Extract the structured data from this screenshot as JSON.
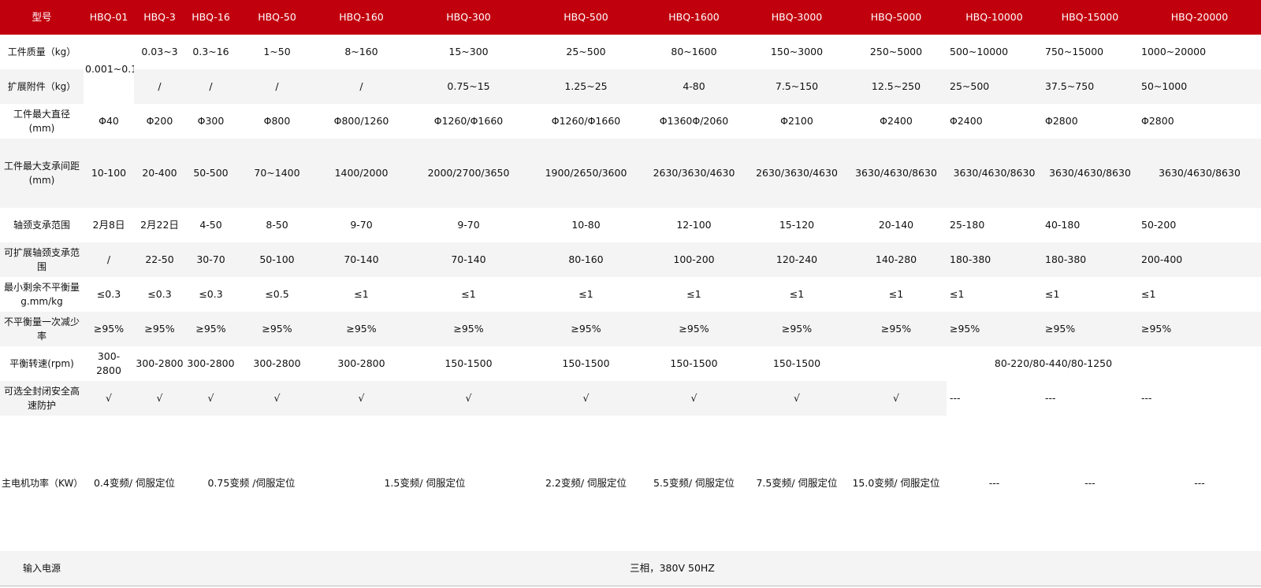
{
  "header": [
    "型号",
    "HBQ-01",
    "HBQ-3",
    "HBQ-16",
    "HBQ-50",
    "HBQ-160",
    "HBQ-300",
    "HBQ-500",
    "HBQ-1600",
    "HBQ-3000",
    "HBQ-5000",
    "HBQ-10000",
    "HBQ-15000",
    "HBQ-20000"
  ],
  "rows": {
    "mass": {
      "label": "工件质量（kg）",
      "hbq01": "0.001~0.1",
      "values": [
        "0.03~3",
        "0.3~16",
        "1~50",
        "8~160",
        "15~300",
        "25~500",
        "80~1600",
        "150~3000",
        "250~5000",
        "500~10000",
        "750~15000",
        "1000~20000"
      ]
    },
    "ext": {
      "label": "扩展附件（kg）",
      "values": [
        "/",
        "/",
        "/",
        "/",
        "0.75~15",
        "1.25~25",
        "4-80",
        "7.5~150",
        "12.5~250",
        "25~500",
        "37.5~750",
        "50~1000"
      ]
    },
    "diameter": {
      "label": "工件最大直径(mm)",
      "values": [
        "Φ40",
        "Φ200",
        "Φ300",
        "Φ800",
        "Φ800/1260",
        "Φ1260/Φ1660",
        "Φ1260/Φ1660",
        "Φ1360Φ/2060",
        "Φ2100",
        "Φ2400",
        "Φ2400",
        "Φ2800",
        "Φ2800"
      ]
    },
    "span": {
      "label": "工件最大支承间距(mm)",
      "values": [
        "10-100",
        "20-400",
        "50-500",
        "70~1400",
        "1400/2000",
        "2000/2700/3650",
        "1900/2650/3600",
        "2630/3630/4630",
        "2630/3630/4630",
        "3630/4630/8630",
        "3630/4630/8630",
        "3630/4630/8630",
        "3630/4630/8630"
      ]
    },
    "journal": {
      "label": "轴颈支承范围",
      "values": [
        "2月8日",
        "2月22日",
        "4-50",
        "8-50",
        "9-70",
        "9-70",
        "10-80",
        "12-100",
        "15-120",
        "20-140",
        "25-180",
        "40-180",
        "50-200"
      ]
    },
    "ext_journal": {
      "label": "可扩展轴颈支承范围",
      "values": [
        "/",
        "22-50",
        "30-70",
        "50-100",
        "70-140",
        "70-140",
        "80-160",
        "100-200",
        "120-240",
        "140-280",
        "180-380",
        "180-380",
        "200-400"
      ]
    },
    "min_unbalance": {
      "label": "最小剩余不平衡量g.mm/kg",
      "values": [
        "≤0.3",
        "≤0.3",
        "≤0.3",
        "≤0.5",
        "≤1",
        "≤1",
        "≤1",
        "≤1",
        "≤1",
        "≤1",
        "≤1",
        "≤1",
        "≤1"
      ]
    },
    "reduction": {
      "label": "不平衡量一次减少率",
      "values": [
        "≥95%",
        "≥95%",
        "≥95%",
        "≥95%",
        "≥95%",
        "≥95%",
        "≥95%",
        "≥95%",
        "≥95%",
        "≥95%",
        "≥95%",
        "≥95%",
        "≥95%"
      ]
    },
    "speed": {
      "label": "平衡转速(rpm)",
      "values": [
        "300-2800",
        "300-2800",
        "300-2800",
        "300-2800",
        "300-2800",
        "150-1500",
        "150-1500",
        "150-1500",
        "150-1500"
      ],
      "merged": "80-220/80-440/80-1250"
    },
    "guard": {
      "label": "可选全封闭安全高速防护",
      "values": [
        "√",
        "√",
        "√",
        "√",
        "√",
        "√",
        "√",
        "√",
        "√",
        "√",
        "---",
        "---",
        "---"
      ]
    },
    "power": {
      "label": "主电机功率（KW）",
      "g1": "0.4变频/ 伺服定位",
      "g2": "0.75变频 /伺服定位",
      "g3": "1.5变频/ 伺服定位",
      "v500": "2.2变频/ 伺服定位",
      "v1600": "5.5变频/ 伺服定位",
      "v3000": "7.5变频/ 伺服定位",
      "v5000": "15.0变频/ 伺服定位",
      "v10000": "---",
      "v15000": "---",
      "v20000": "---"
    },
    "supply": {
      "label": "输入电源",
      "value": "三相，380V 50HZ"
    }
  },
  "colors": {
    "header_bg": "#c1000d",
    "stripe": "#f4f4f4"
  }
}
